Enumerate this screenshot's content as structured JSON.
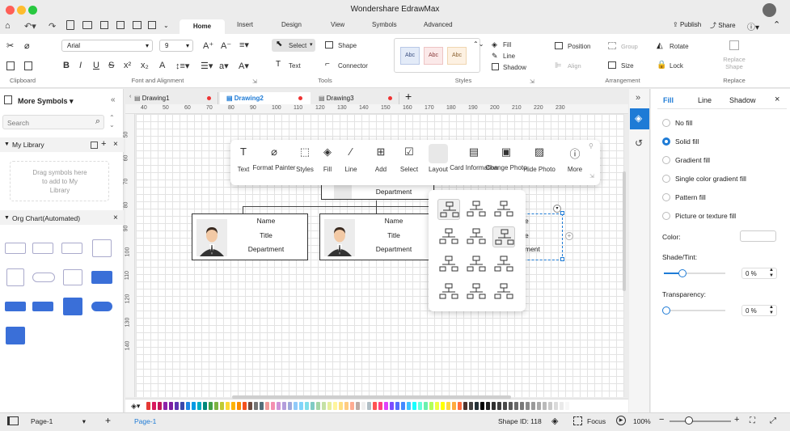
{
  "app": {
    "title": "Wondershare EdrawMax"
  },
  "ribbon_tabs": [
    {
      "label": "Home",
      "active": true
    },
    {
      "label": "Insert"
    },
    {
      "label": "Design"
    },
    {
      "label": "View"
    },
    {
      "label": "Symbols"
    },
    {
      "label": "Advanced"
    }
  ],
  "account": {
    "publish": "Publish",
    "share": "Share"
  },
  "ribbon": {
    "font_name": "Arial",
    "font_size": "9",
    "select": "Select",
    "text": "Text",
    "shape": "Shape",
    "connector": "Connector",
    "style_sample": "Abc",
    "fill": "Fill",
    "line": "Line",
    "shadow": "Shadow",
    "position": "Position",
    "group": "Group",
    "align": "Align",
    "size": "Size",
    "rotate": "Rotate",
    "lock": "Lock",
    "replace_shape": "Replace Shape",
    "groups": {
      "clipboard": "Clipboard",
      "font": "Font and Alignment",
      "tools": "Tools",
      "styles": "Styles",
      "arrangement": "Arrangement",
      "replace": "Replace"
    }
  },
  "left_panel": {
    "title": "More Symbols",
    "search_placeholder": "Search",
    "my_library": "My Library",
    "drag_hint": "Drag symbols here to add to My Library",
    "org_chart": "Org Chart(Automated)"
  },
  "doc_tabs": [
    {
      "label": "Drawing1"
    },
    {
      "label": "Drawing2",
      "active": true
    },
    {
      "label": "Drawing3"
    }
  ],
  "ruler_top": [
    "40",
    "50",
    "60",
    "70",
    "80",
    "90",
    "100",
    "110",
    "120",
    "130",
    "140",
    "150",
    "160",
    "170",
    "180",
    "190",
    "200",
    "210",
    "220",
    "230"
  ],
  "ruler_left": [
    "50",
    "60",
    "70",
    "80",
    "90",
    "100",
    "110",
    "120",
    "130",
    "140"
  ],
  "float_toolbar": [
    {
      "label": "Text",
      "icon": "text-icon"
    },
    {
      "label": "Format Painter",
      "icon": "format-painter-icon"
    },
    {
      "label": "Styles",
      "icon": "styles-icon"
    },
    {
      "label": "Fill",
      "icon": "fill-icon"
    },
    {
      "label": "Line",
      "icon": "line-icon"
    },
    {
      "label": "Add",
      "icon": "add-icon"
    },
    {
      "label": "Select",
      "icon": "select-icon"
    },
    {
      "label": "Layout",
      "icon": "layout-icon"
    },
    {
      "label": "Card Information",
      "icon": "card-icon"
    },
    {
      "label": "Change Photo",
      "icon": "photo-icon"
    },
    {
      "label": "Hide Photo",
      "icon": "hide-photo-icon"
    },
    {
      "label": "More",
      "icon": "more-icon"
    }
  ],
  "cards": [
    {
      "name": "Name",
      "title": "Title",
      "department": "Department"
    },
    {
      "name": "Name",
      "title": "Title",
      "department": "Department"
    }
  ],
  "partial_texts": {
    "top_department": "Department",
    "right_e1": "e",
    "right_e2": "e",
    "right_ment": "ment"
  },
  "right_panel": {
    "tabs": [
      "Fill",
      "Line",
      "Shadow"
    ],
    "options": [
      "No fill",
      "Solid fill",
      "Gradient fill",
      "Single color gradient fill",
      "Pattern fill",
      "Picture or texture fill"
    ],
    "selected_option": "Solid fill",
    "color_label": "Color:",
    "shade_label": "Shade/Tint:",
    "shade_value": "0 %",
    "shade_level": 0.3,
    "transparency_label": "Transparency:",
    "transparency_value": "0 %",
    "transparency_level": 0
  },
  "status": {
    "page_select": "Page-1",
    "page_tab": "Page-1",
    "shape_id": "Shape ID: 118",
    "focus": "Focus",
    "zoom": "100%"
  },
  "colors": {
    "accent": "#1e7bd6",
    "tab_dot": "#e33"
  }
}
